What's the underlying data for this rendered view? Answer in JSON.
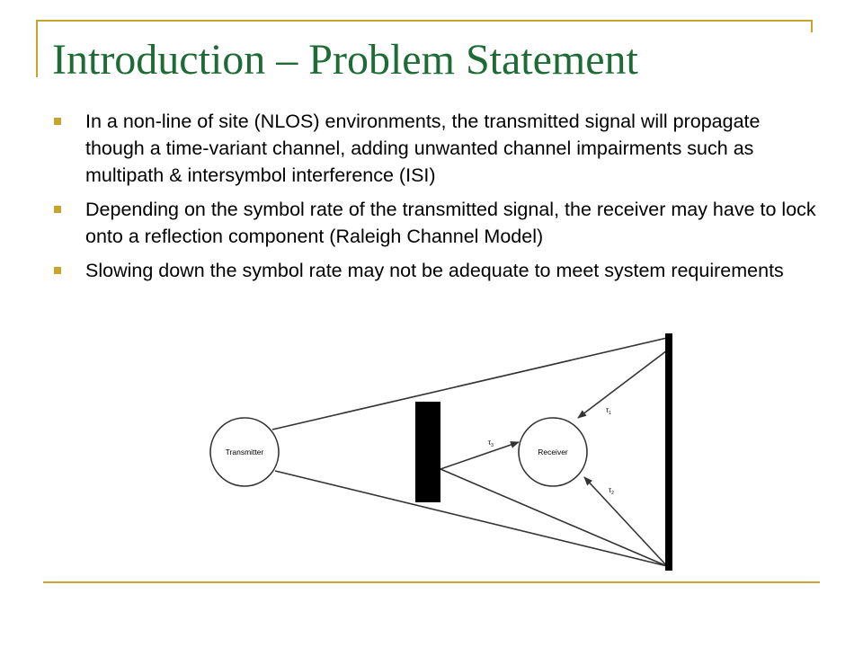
{
  "slide": {
    "title": "Introduction – Problem Statement",
    "accent_color": "#c8a42c",
    "title_color": "#1f6b35",
    "bullets": [
      {
        "text": "In a non-line of site (NLOS) environments, the transmitted signal will propagate though a time-variant channel, adding unwanted channel impairments such as multipath & intersymbol interference (ISI)"
      },
      {
        "text": "Depending on the symbol rate of the transmitted signal, the receiver may have to lock onto a reflection component (Raleigh Channel Model)"
      },
      {
        "text": "Slowing down the symbol rate may not be adequate to meet system requirements"
      }
    ]
  },
  "diagram": {
    "transmitter_label": "Transmitter",
    "receiver_label": "Receiver",
    "tau_symbol": "τ",
    "delays": [
      {
        "subscript": "1"
      },
      {
        "subscript": "2"
      },
      {
        "subscript": "3"
      }
    ]
  }
}
